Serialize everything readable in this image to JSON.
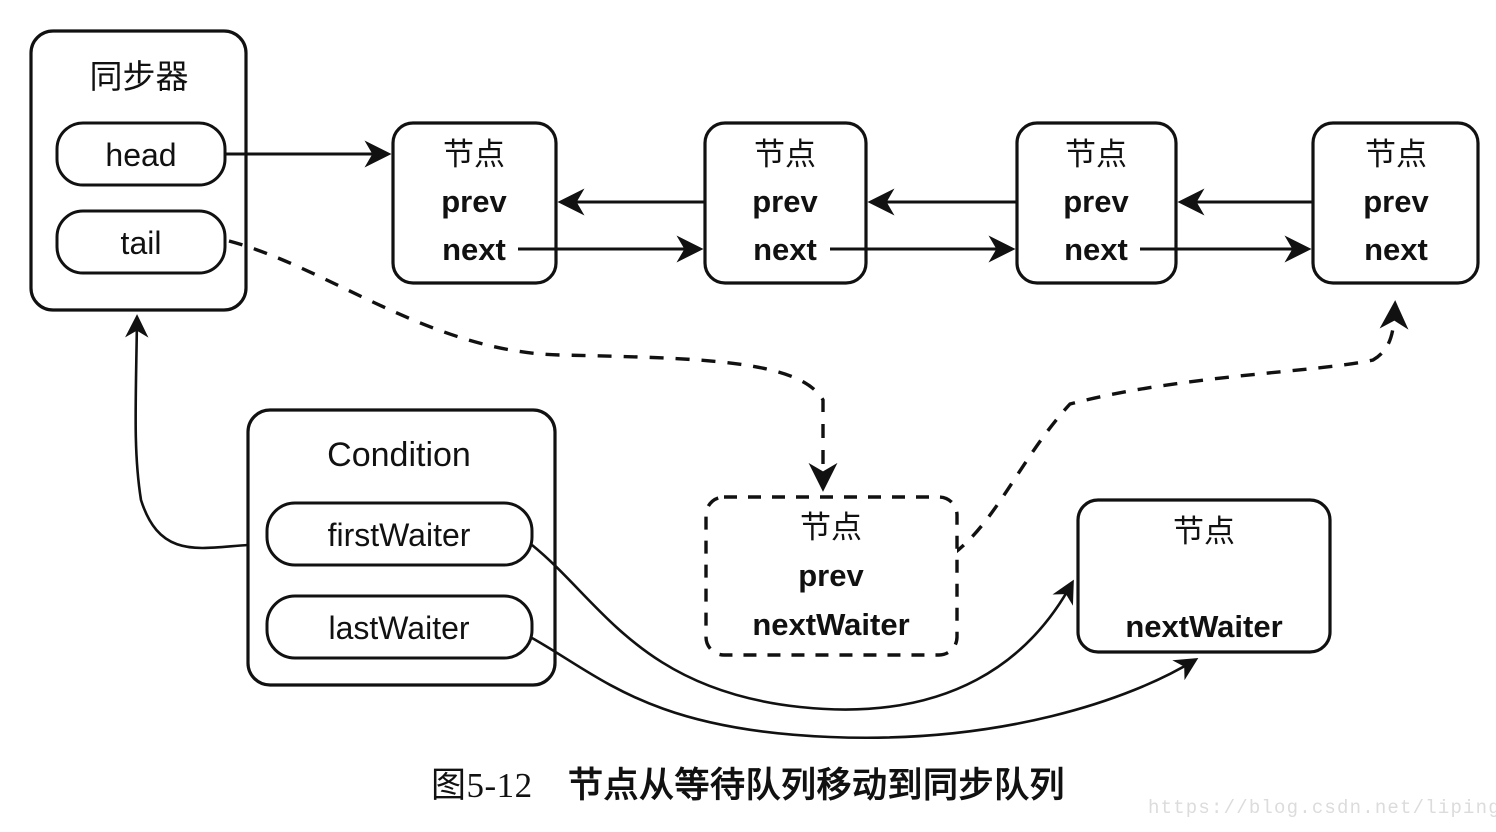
{
  "figure": {
    "caption_number": "图5-12",
    "caption_text": "节点从等待队列移动到同步队列",
    "watermark": "https://blog.csdn.net/lipinganq"
  },
  "synchronizer": {
    "title": "同步器",
    "fields": [
      {
        "label": "head"
      },
      {
        "label": "tail"
      }
    ]
  },
  "sync_queue": {
    "nodes": [
      {
        "title": "节点",
        "field1": "prev",
        "field2": "next"
      },
      {
        "title": "节点",
        "field1": "prev",
        "field2": "next"
      },
      {
        "title": "节点",
        "field1": "prev",
        "field2": "next"
      },
      {
        "title": "节点",
        "field1": "prev",
        "field2": "next"
      }
    ]
  },
  "condition": {
    "title": "Condition",
    "fields": [
      {
        "label": "firstWaiter"
      },
      {
        "label": "lastWaiter"
      }
    ]
  },
  "moving_node": {
    "title": "节点",
    "field1": "prev",
    "field2": "nextWaiter"
  },
  "waiter_node": {
    "title": "节点",
    "field1": "nextWaiter"
  },
  "colors": {
    "stroke": "#111111",
    "background": "#ffffff",
    "watermark": "#dcdcdc"
  }
}
